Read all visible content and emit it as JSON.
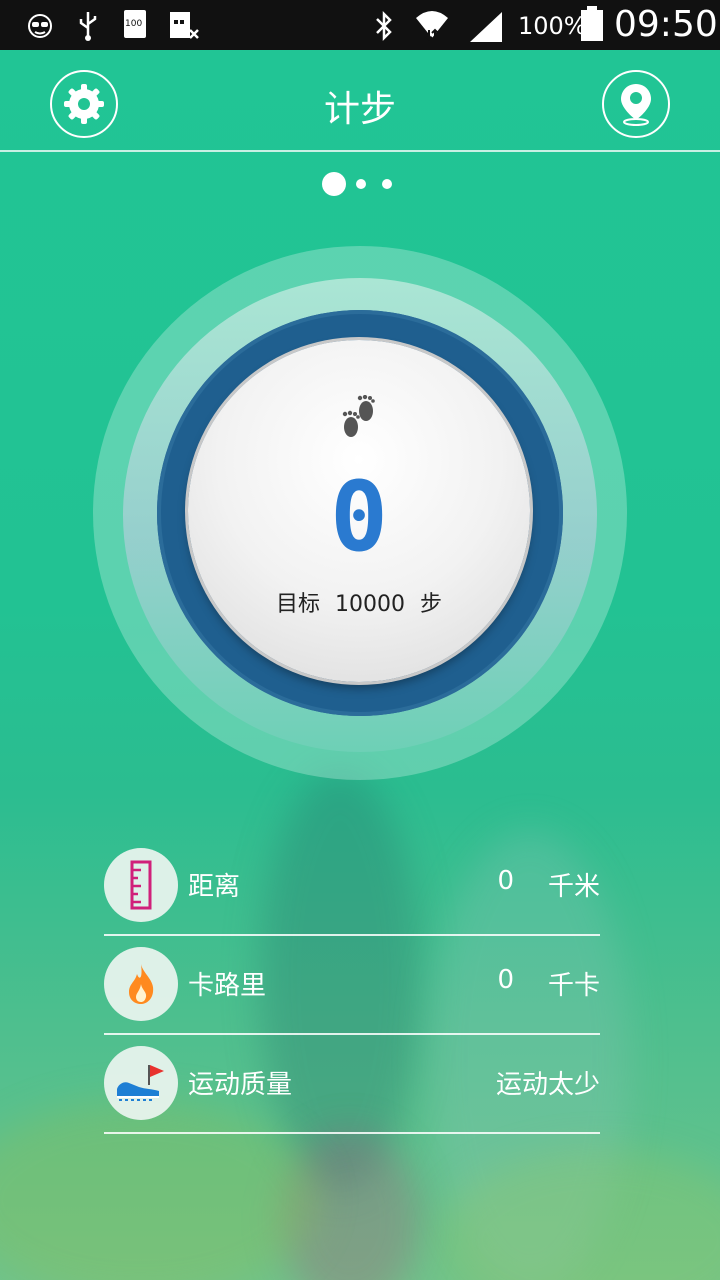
{
  "status_bar": {
    "battery_percent": "100%",
    "time": "09:50",
    "sim_label": "100"
  },
  "header": {
    "title": "计步"
  },
  "pager": {
    "count": 3,
    "active_index": 0
  },
  "pedometer": {
    "steps": "0",
    "goal_label": "目标",
    "goal_value": "10000",
    "goal_unit": "步"
  },
  "stats": [
    {
      "label": "距离",
      "value": "0",
      "unit": "千米",
      "icon": "ruler-icon"
    },
    {
      "label": "卡路里",
      "value": "0",
      "unit": "千卡",
      "icon": "flame-icon"
    },
    {
      "label": "运动质量",
      "value": "运动太少",
      "icon": "running-shoe-icon"
    }
  ],
  "colors": {
    "background": "#22c493",
    "ring_dark": "#1f5f8f",
    "step_value": "#2a7ad0",
    "ruler": "#d0207a",
    "flame": "#ff8a1f",
    "flag": "#e8322e",
    "shoe": "#1e7fd4"
  }
}
